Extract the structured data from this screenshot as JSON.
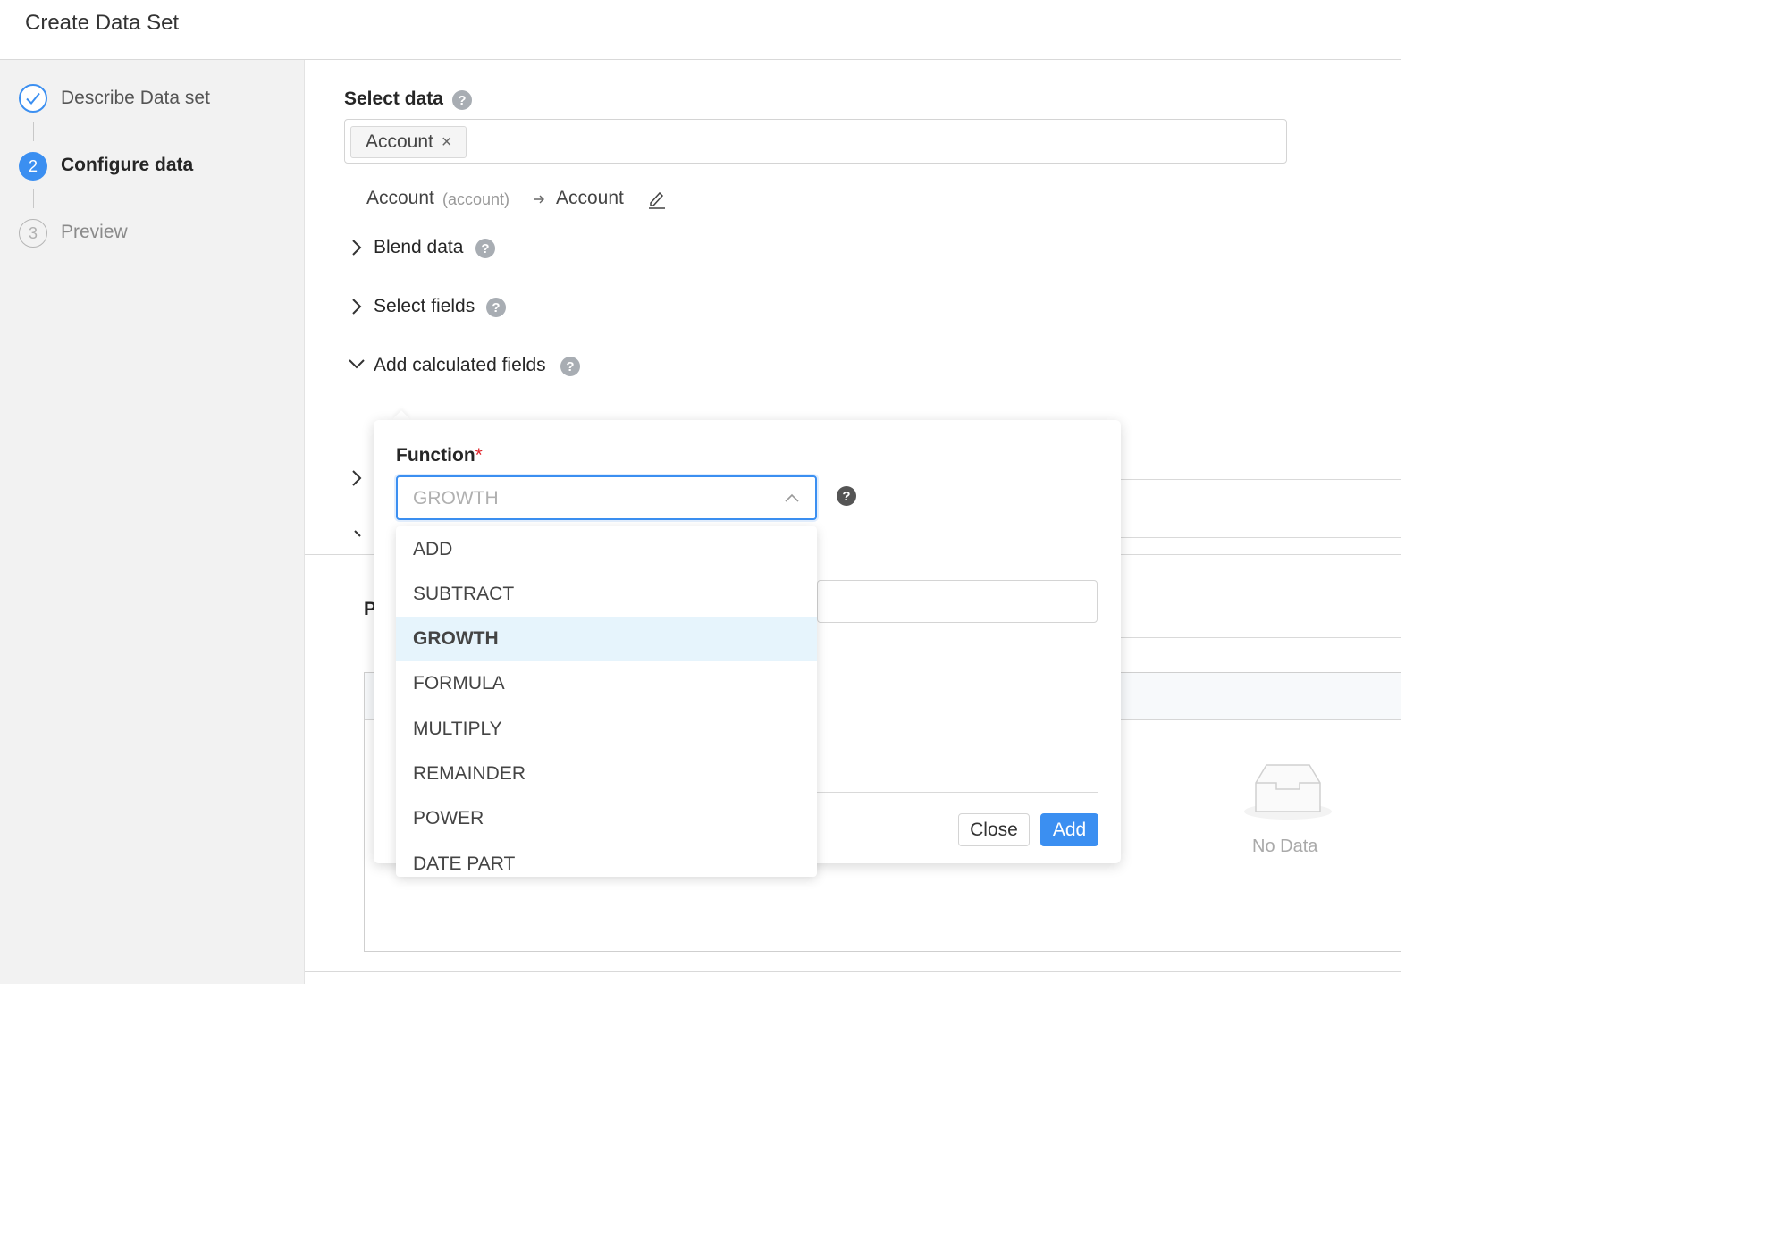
{
  "header": {
    "title": "Create Data Set"
  },
  "steps": [
    {
      "number": "1",
      "label": "Describe Data set",
      "state": "done"
    },
    {
      "number": "2",
      "label": "Configure data",
      "state": "active"
    },
    {
      "number": "3",
      "label": "Preview",
      "state": "todo"
    }
  ],
  "select_data": {
    "label": "Select data",
    "help_glyph": "?",
    "tag_label": "Account",
    "tag_remove_glyph": "×"
  },
  "mapping": {
    "source_name": "Account",
    "source_api": "(account)",
    "arrow_glyph": "→",
    "target_name": "Account"
  },
  "sections": {
    "blend": "Blend data",
    "fields": "Select fields",
    "calculated": "Add calculated fields",
    "help_glyph": "?"
  },
  "preview": {
    "truncated_heading": "P",
    "empty_text": "No Data"
  },
  "calc_popover": {
    "function_label": "Function",
    "required_mark": "*",
    "selected_value": "GROWTH",
    "help_glyph": "?",
    "options": [
      "ADD",
      "SUBTRACT",
      "GROWTH",
      "FORMULA",
      "MULTIPLY",
      "REMAINDER",
      "POWER",
      "DATE PART"
    ],
    "close_label": "Close",
    "add_label": "Add"
  },
  "colors": {
    "accent": "#3b8ff1",
    "option_highlight": "#e6f4fc",
    "sidebar_bg": "#f2f2f2"
  },
  "icons": [
    "check-icon",
    "help-icon",
    "close-icon",
    "arrow-right-icon",
    "edit-icon",
    "chevron-right-icon",
    "chevron-down-icon",
    "chevron-up-icon",
    "empty-inbox-icon"
  ]
}
